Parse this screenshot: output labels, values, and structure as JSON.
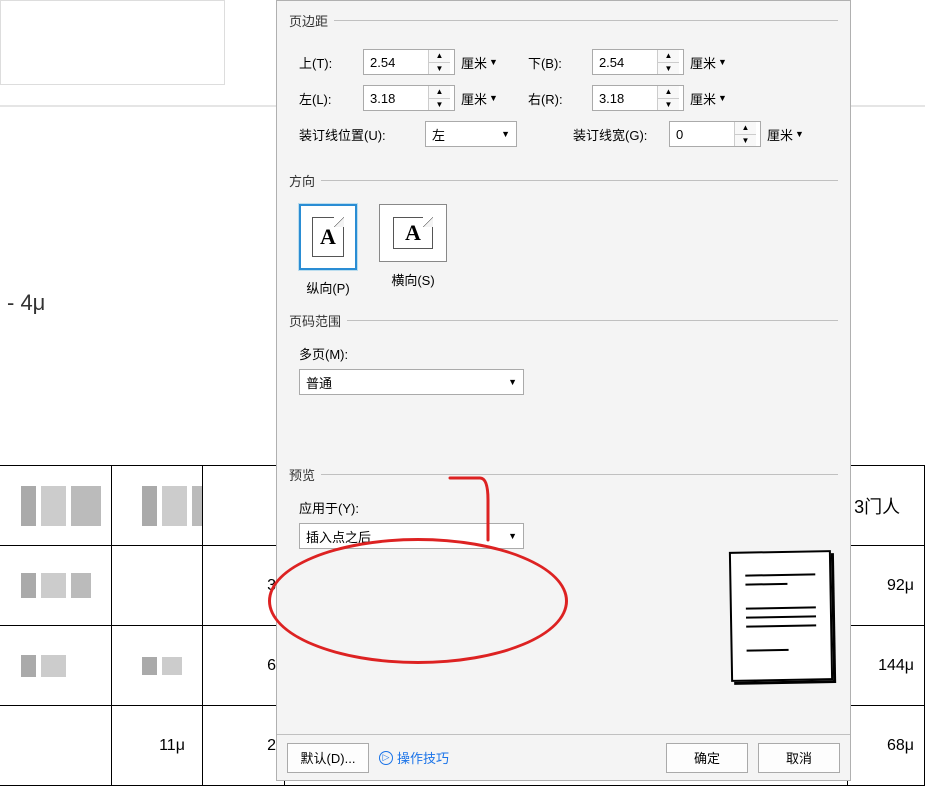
{
  "background": {
    "left_marker": "- 4μ",
    "col_header_right": "3门人",
    "rows": [
      {
        "c1": "",
        "c2": "",
        "c3": "",
        "c4": ""
      },
      {
        "c1": "",
        "c2": "",
        "c3": "3",
        "c4": "92μ"
      },
      {
        "c1": "",
        "c2": "",
        "c3": "6",
        "c4": "144μ"
      },
      {
        "c1": "",
        "c2": "11μ",
        "c3": "2",
        "c4": "68μ"
      }
    ]
  },
  "margins": {
    "legend": "页边距",
    "top_label": "上(T):",
    "top_value": "2.54",
    "bottom_label": "下(B):",
    "bottom_value": "2.54",
    "left_label": "左(L):",
    "left_value": "3.18",
    "right_label": "右(R):",
    "right_value": "3.18",
    "gutter_pos_label": "装订线位置(U):",
    "gutter_pos_value": "左",
    "gutter_width_label": "装订线宽(G):",
    "gutter_width_value": "0",
    "unit": "厘米"
  },
  "orientation": {
    "legend": "方向",
    "glyph": "A",
    "portrait_label": "纵向(P)",
    "landscape_label": "横向(S)"
  },
  "page_range": {
    "legend": "页码范围",
    "multi_label": "多页(M):",
    "multi_value": "普通"
  },
  "preview": {
    "legend": "预览",
    "apply_label": "应用于(Y):",
    "apply_value": "插入点之后"
  },
  "footer": {
    "default_btn": "默认(D)...",
    "tips_link": "操作技巧",
    "ok_btn": "确定",
    "cancel_btn": "取消"
  },
  "icons": {
    "dropdown_glyph": "▼",
    "up_glyph": "▲",
    "down_glyph": "▼",
    "play_glyph": "▷"
  }
}
